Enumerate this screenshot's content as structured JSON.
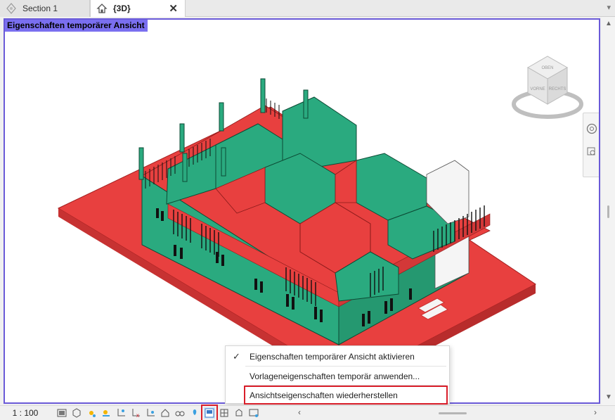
{
  "tabs": [
    {
      "label": "Section 1",
      "icon": "section-icon",
      "active": false
    },
    {
      "label": "{3D}",
      "icon": "house-icon",
      "active": true,
      "close": "✕"
    }
  ],
  "viewport": {
    "label": "Eigenschaften temporärer Ansicht",
    "border_color": "#6a5ad8",
    "label_bg": "#7a6ff0"
  },
  "viewcube": {
    "top": "OBEN",
    "front": "VORNE",
    "right": "RECHTS"
  },
  "statusbar": {
    "scale": "1 : 100"
  },
  "context_menu": {
    "items": [
      {
        "label": "Eigenschaften temporärer Ansicht aktivieren",
        "checked": true
      },
      {
        "label": "Vorlageneigenschaften temporär anwenden..."
      },
      {
        "label": "Ansichtseigenschaften wiederherstellen",
        "highlighted": true
      }
    ]
  },
  "colors": {
    "floor_red": "#e8403f",
    "wall_green": "#2aaa7f",
    "highlight_red": "#d91e2a"
  }
}
